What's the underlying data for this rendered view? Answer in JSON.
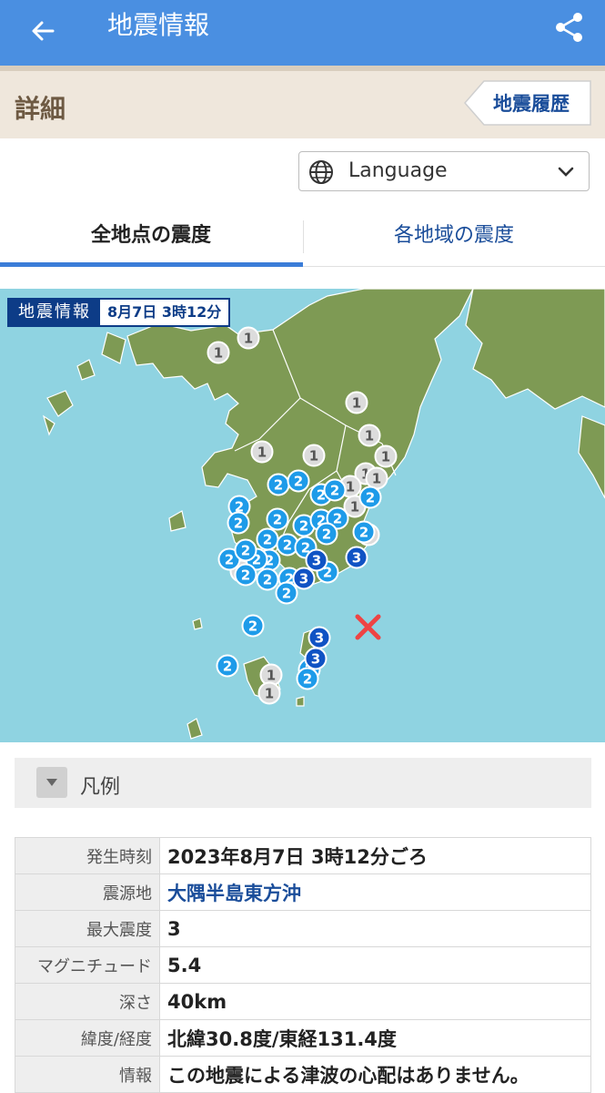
{
  "header": {
    "title": "地震情報",
    "back_icon": "arrow-left-icon",
    "share_icon": "share-icon"
  },
  "detail": {
    "label": "詳細",
    "history_button": "地震履歴"
  },
  "language": {
    "label": "Language",
    "icon": "globe-icon"
  },
  "tabs": [
    {
      "label": "全地点の震度",
      "active": true
    },
    {
      "label": "各地域の震度",
      "active": false
    }
  ],
  "map": {
    "badge_title": "地震情報",
    "badge_time": "8月7日 3時12分",
    "epicenter_icon": "x-mark-icon",
    "markers": [
      {
        "label": "1"
      },
      {
        "label": "1"
      },
      {
        "label": "1"
      },
      {
        "label": "1"
      },
      {
        "label": "1"
      },
      {
        "label": "1"
      },
      {
        "label": "1"
      },
      {
        "label": "1"
      },
      {
        "label": "1"
      },
      {
        "label": "1"
      },
      {
        "label": "1"
      },
      {
        "label": "1"
      },
      {
        "label": "1"
      },
      {
        "label": "1"
      },
      {
        "label": "1"
      },
      {
        "label": "2"
      },
      {
        "label": "2"
      },
      {
        "label": "2"
      },
      {
        "label": "2"
      },
      {
        "label": "2"
      },
      {
        "label": "2"
      },
      {
        "label": "2"
      },
      {
        "label": "2"
      },
      {
        "label": "2"
      },
      {
        "label": "2"
      },
      {
        "label": "2"
      },
      {
        "label": "2"
      },
      {
        "label": "2"
      },
      {
        "label": "2"
      },
      {
        "label": "2"
      },
      {
        "label": "2"
      },
      {
        "label": "2"
      },
      {
        "label": "2"
      },
      {
        "label": "2"
      },
      {
        "label": "2"
      },
      {
        "label": "2"
      },
      {
        "label": "2"
      },
      {
        "label": "2"
      },
      {
        "label": "2"
      },
      {
        "label": "2"
      },
      {
        "label": "2"
      },
      {
        "label": "2"
      },
      {
        "label": "2"
      },
      {
        "label": "2"
      },
      {
        "label": "3"
      },
      {
        "label": "3"
      },
      {
        "label": "3"
      },
      {
        "label": "3"
      },
      {
        "label": "3"
      }
    ],
    "colors": {
      "sea": "#8fd3e1",
      "land": "#7e9a54",
      "border": "#ffffff",
      "int1": "#dcdcdc",
      "int2": "#1e9be9",
      "int3": "#1053c4"
    }
  },
  "legend": {
    "label": "凡例",
    "icon": "triangle-down-icon"
  },
  "info": [
    {
      "key": "発生時刻",
      "value": "2023年8月7日 3時12分ごろ"
    },
    {
      "key": "震源地",
      "value": "大隅半島東方沖"
    },
    {
      "key": "最大震度",
      "value": "3"
    },
    {
      "key": "マグニチュード",
      "value": "5.4"
    },
    {
      "key": "深さ",
      "value": "40km"
    },
    {
      "key": "緯度/経度",
      "value": "北緯30.8度/東経131.4度"
    },
    {
      "key": "情報",
      "value": "この地震による津波の心配はありません。"
    }
  ]
}
